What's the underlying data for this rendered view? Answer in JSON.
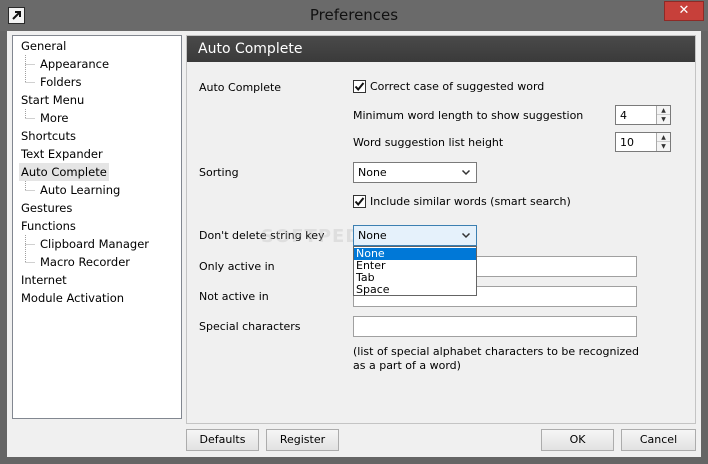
{
  "window": {
    "title": "Preferences",
    "close_symbol": "✕"
  },
  "tree": {
    "items": [
      {
        "label": "General",
        "level": 0
      },
      {
        "label": "Appearance",
        "level": 1
      },
      {
        "label": "Folders",
        "level": 1
      },
      {
        "label": "Start Menu",
        "level": 0
      },
      {
        "label": "More",
        "level": 1
      },
      {
        "label": "Shortcuts",
        "level": 0
      },
      {
        "label": "Text Expander",
        "level": 0
      },
      {
        "label": "Auto Complete",
        "level": 0,
        "selected": true
      },
      {
        "label": "Auto Learning",
        "level": 1
      },
      {
        "label": "Gestures",
        "level": 0
      },
      {
        "label": "Functions",
        "level": 0
      },
      {
        "label": "Clipboard Manager",
        "level": 1
      },
      {
        "label": "Macro Recorder",
        "level": 1
      },
      {
        "label": "Internet",
        "level": 0
      },
      {
        "label": "Module Activation",
        "level": 0
      }
    ]
  },
  "panel": {
    "header": "Auto Complete",
    "auto_complete_label": "Auto Complete",
    "correct_case_label": "Correct case of suggested word",
    "correct_case_checked": true,
    "min_length_label": "Minimum word length to show suggestion",
    "min_length_value": "4",
    "list_height_label": "Word suggestion list height",
    "list_height_value": "10",
    "sorting_label": "Sorting",
    "sorting_value": "None",
    "similar_words_label": "Include similar words (smart search)",
    "similar_words_checked": true,
    "dont_delete_label": "Don't delete string key",
    "dont_delete_value": "None",
    "dont_delete_options": [
      "None",
      "Enter",
      "Tab",
      "Space"
    ],
    "only_active_label": "Only active in",
    "only_active_value": "",
    "not_active_label": "Not active in",
    "not_active_value": "",
    "special_chars_label": "Special characters",
    "special_chars_value": "",
    "special_chars_note_line1": "(list of special alphabet characters to be recognized",
    "special_chars_note_line2": "as a part of a word)"
  },
  "buttons": {
    "defaults": "Defaults",
    "register": "Register",
    "ok": "OK",
    "cancel": "Cancel"
  },
  "watermark": "SOFTPEDIA",
  "icons": {
    "app": "arrow-icon",
    "close": "close-icon",
    "check": "check-icon",
    "dropdown": "chevron-down-icon",
    "spin_up": "triangle-up-icon",
    "spin_down": "triangle-down-icon"
  }
}
